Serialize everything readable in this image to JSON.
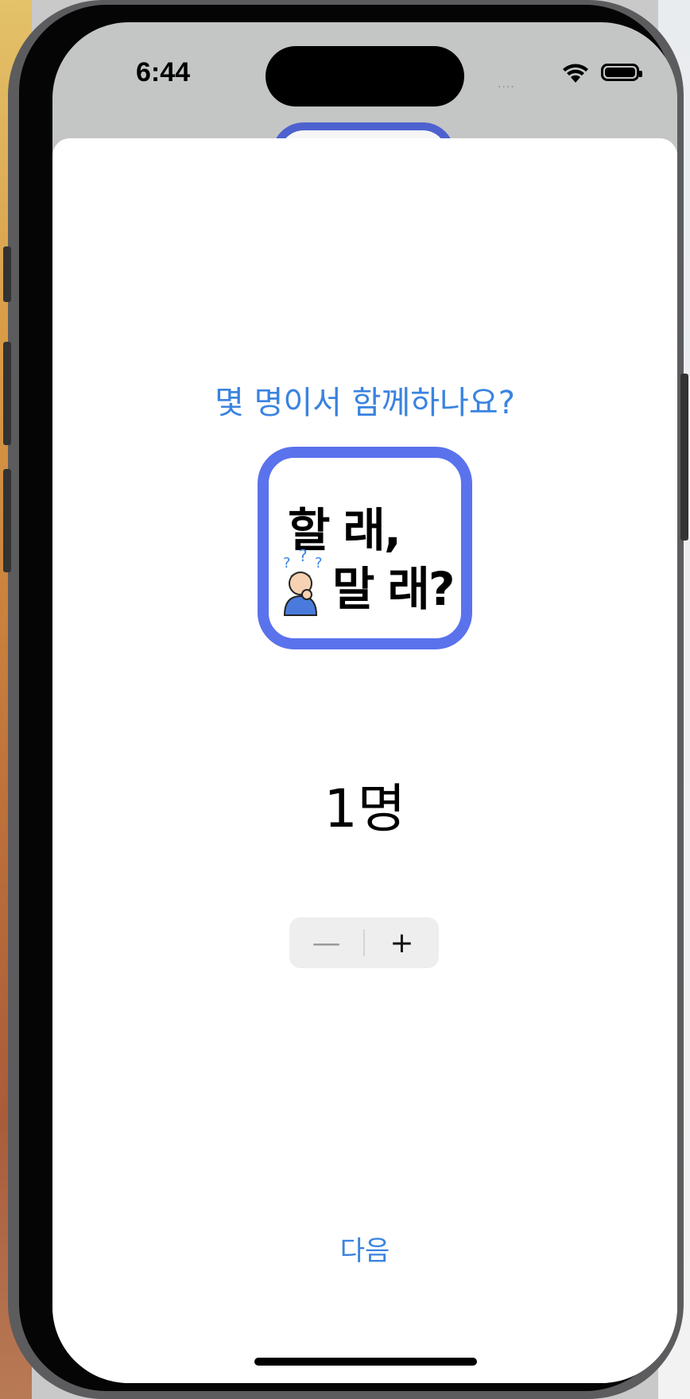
{
  "status_bar": {
    "time": "6:44",
    "signal": "....",
    "wifi_icon": "wifi-icon",
    "battery_icon": "battery-full-icon"
  },
  "screen": {
    "question": "몇 명이서 함께하나요?",
    "logo": {
      "line1": "할 래,",
      "line2": "말 래?",
      "question_marks": "???",
      "person_icon": "thinking-person-icon",
      "border_color": "#5a72ec"
    },
    "count_value": "1명",
    "stepper": {
      "minus": "—",
      "plus": "+",
      "minus_enabled": false
    },
    "next_button": "다음"
  },
  "colors": {
    "accent": "#3a83e0",
    "sheet_background": "#ffffff"
  }
}
